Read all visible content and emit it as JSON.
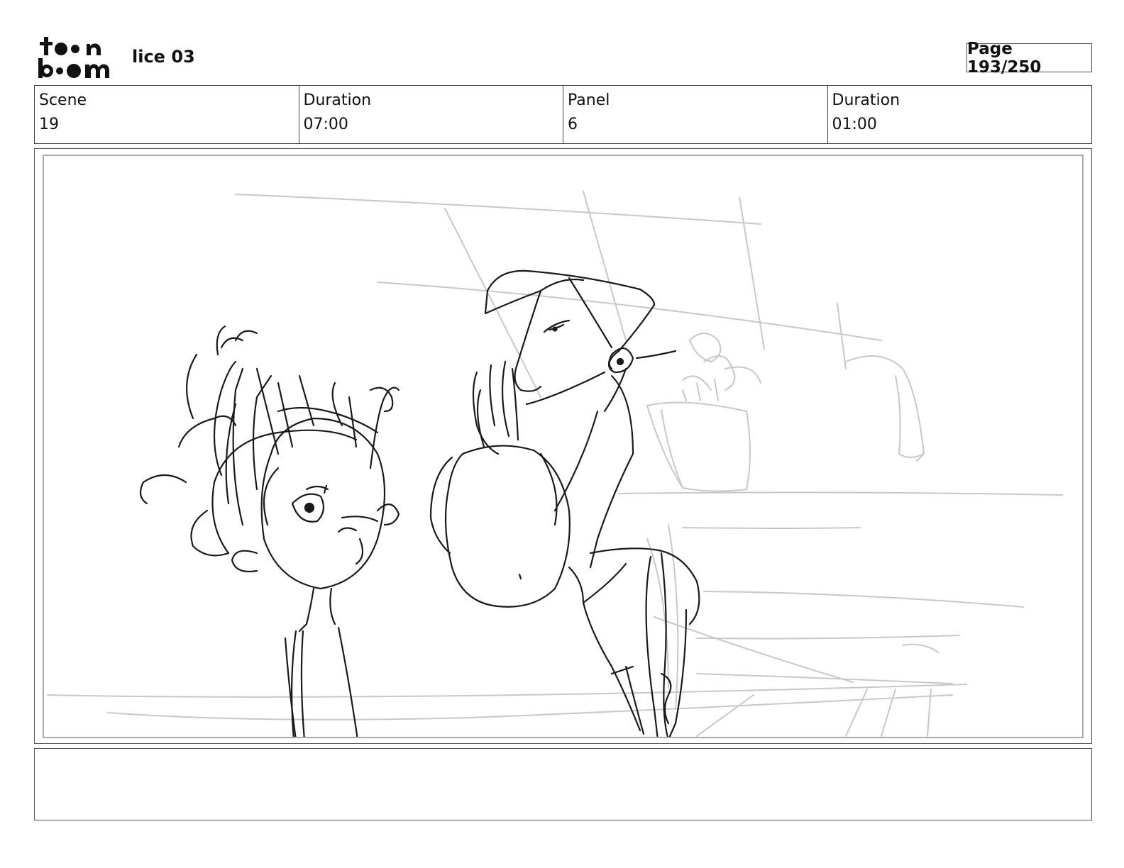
{
  "header": {
    "logo_text": "toonboom",
    "project_title": "lice 03",
    "page_label": "Page 193/250"
  },
  "info": {
    "scene_label": "Scene",
    "scene_value": "19",
    "scene_duration_label": "Duration",
    "scene_duration_value": "07:00",
    "panel_label": "Panel",
    "panel_value": "6",
    "panel_duration_label": "Duration",
    "panel_duration_value": "01:00"
  },
  "panel": {
    "image_icon": "storyboard-sketch"
  },
  "notes": {
    "text": ""
  }
}
